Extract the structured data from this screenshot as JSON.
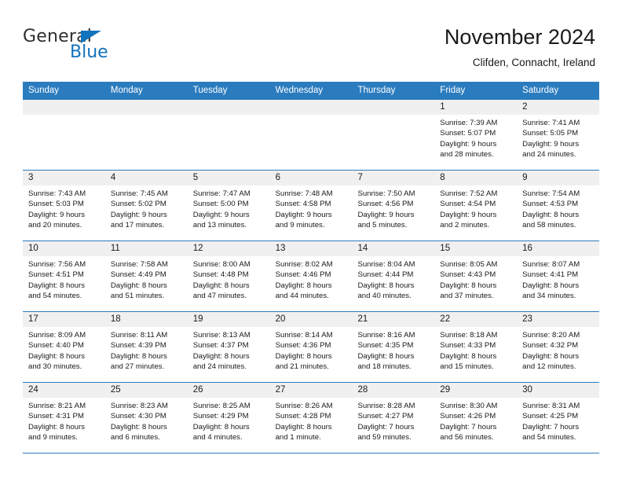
{
  "logo": {
    "word_top": "General",
    "word_bottom": "Blue",
    "triangle_color": "#1273bd",
    "text_color": "#2e2e2e"
  },
  "header": {
    "title": "November 2024",
    "subtitle": "Clifden, Connacht, Ireland"
  },
  "theme": {
    "header_band": "#2b7cbf",
    "daynum_band": "#f0f0f0",
    "rule": "#2b7cbf"
  },
  "weekdays": [
    "Sunday",
    "Monday",
    "Tuesday",
    "Wednesday",
    "Thursday",
    "Friday",
    "Saturday"
  ],
  "weeks": [
    [
      {
        "day": "",
        "lines": []
      },
      {
        "day": "",
        "lines": []
      },
      {
        "day": "",
        "lines": []
      },
      {
        "day": "",
        "lines": []
      },
      {
        "day": "",
        "lines": []
      },
      {
        "day": "1",
        "lines": [
          "Sunrise: 7:39 AM",
          "Sunset: 5:07 PM",
          "Daylight: 9 hours",
          "and 28 minutes."
        ]
      },
      {
        "day": "2",
        "lines": [
          "Sunrise: 7:41 AM",
          "Sunset: 5:05 PM",
          "Daylight: 9 hours",
          "and 24 minutes."
        ]
      }
    ],
    [
      {
        "day": "3",
        "lines": [
          "Sunrise: 7:43 AM",
          "Sunset: 5:03 PM",
          "Daylight: 9 hours",
          "and 20 minutes."
        ]
      },
      {
        "day": "4",
        "lines": [
          "Sunrise: 7:45 AM",
          "Sunset: 5:02 PM",
          "Daylight: 9 hours",
          "and 17 minutes."
        ]
      },
      {
        "day": "5",
        "lines": [
          "Sunrise: 7:47 AM",
          "Sunset: 5:00 PM",
          "Daylight: 9 hours",
          "and 13 minutes."
        ]
      },
      {
        "day": "6",
        "lines": [
          "Sunrise: 7:48 AM",
          "Sunset: 4:58 PM",
          "Daylight: 9 hours",
          "and 9 minutes."
        ]
      },
      {
        "day": "7",
        "lines": [
          "Sunrise: 7:50 AM",
          "Sunset: 4:56 PM",
          "Daylight: 9 hours",
          "and 5 minutes."
        ]
      },
      {
        "day": "8",
        "lines": [
          "Sunrise: 7:52 AM",
          "Sunset: 4:54 PM",
          "Daylight: 9 hours",
          "and 2 minutes."
        ]
      },
      {
        "day": "9",
        "lines": [
          "Sunrise: 7:54 AM",
          "Sunset: 4:53 PM",
          "Daylight: 8 hours",
          "and 58 minutes."
        ]
      }
    ],
    [
      {
        "day": "10",
        "lines": [
          "Sunrise: 7:56 AM",
          "Sunset: 4:51 PM",
          "Daylight: 8 hours",
          "and 54 minutes."
        ]
      },
      {
        "day": "11",
        "lines": [
          "Sunrise: 7:58 AM",
          "Sunset: 4:49 PM",
          "Daylight: 8 hours",
          "and 51 minutes."
        ]
      },
      {
        "day": "12",
        "lines": [
          "Sunrise: 8:00 AM",
          "Sunset: 4:48 PM",
          "Daylight: 8 hours",
          "and 47 minutes."
        ]
      },
      {
        "day": "13",
        "lines": [
          "Sunrise: 8:02 AM",
          "Sunset: 4:46 PM",
          "Daylight: 8 hours",
          "and 44 minutes."
        ]
      },
      {
        "day": "14",
        "lines": [
          "Sunrise: 8:04 AM",
          "Sunset: 4:44 PM",
          "Daylight: 8 hours",
          "and 40 minutes."
        ]
      },
      {
        "day": "15",
        "lines": [
          "Sunrise: 8:05 AM",
          "Sunset: 4:43 PM",
          "Daylight: 8 hours",
          "and 37 minutes."
        ]
      },
      {
        "day": "16",
        "lines": [
          "Sunrise: 8:07 AM",
          "Sunset: 4:41 PM",
          "Daylight: 8 hours",
          "and 34 minutes."
        ]
      }
    ],
    [
      {
        "day": "17",
        "lines": [
          "Sunrise: 8:09 AM",
          "Sunset: 4:40 PM",
          "Daylight: 8 hours",
          "and 30 minutes."
        ]
      },
      {
        "day": "18",
        "lines": [
          "Sunrise: 8:11 AM",
          "Sunset: 4:39 PM",
          "Daylight: 8 hours",
          "and 27 minutes."
        ]
      },
      {
        "day": "19",
        "lines": [
          "Sunrise: 8:13 AM",
          "Sunset: 4:37 PM",
          "Daylight: 8 hours",
          "and 24 minutes."
        ]
      },
      {
        "day": "20",
        "lines": [
          "Sunrise: 8:14 AM",
          "Sunset: 4:36 PM",
          "Daylight: 8 hours",
          "and 21 minutes."
        ]
      },
      {
        "day": "21",
        "lines": [
          "Sunrise: 8:16 AM",
          "Sunset: 4:35 PM",
          "Daylight: 8 hours",
          "and 18 minutes."
        ]
      },
      {
        "day": "22",
        "lines": [
          "Sunrise: 8:18 AM",
          "Sunset: 4:33 PM",
          "Daylight: 8 hours",
          "and 15 minutes."
        ]
      },
      {
        "day": "23",
        "lines": [
          "Sunrise: 8:20 AM",
          "Sunset: 4:32 PM",
          "Daylight: 8 hours",
          "and 12 minutes."
        ]
      }
    ],
    [
      {
        "day": "24",
        "lines": [
          "Sunrise: 8:21 AM",
          "Sunset: 4:31 PM",
          "Daylight: 8 hours",
          "and 9 minutes."
        ]
      },
      {
        "day": "25",
        "lines": [
          "Sunrise: 8:23 AM",
          "Sunset: 4:30 PM",
          "Daylight: 8 hours",
          "and 6 minutes."
        ]
      },
      {
        "day": "26",
        "lines": [
          "Sunrise: 8:25 AM",
          "Sunset: 4:29 PM",
          "Daylight: 8 hours",
          "and 4 minutes."
        ]
      },
      {
        "day": "27",
        "lines": [
          "Sunrise: 8:26 AM",
          "Sunset: 4:28 PM",
          "Daylight: 8 hours",
          "and 1 minute."
        ]
      },
      {
        "day": "28",
        "lines": [
          "Sunrise: 8:28 AM",
          "Sunset: 4:27 PM",
          "Daylight: 7 hours",
          "and 59 minutes."
        ]
      },
      {
        "day": "29",
        "lines": [
          "Sunrise: 8:30 AM",
          "Sunset: 4:26 PM",
          "Daylight: 7 hours",
          "and 56 minutes."
        ]
      },
      {
        "day": "30",
        "lines": [
          "Sunrise: 8:31 AM",
          "Sunset: 4:25 PM",
          "Daylight: 7 hours",
          "and 54 minutes."
        ]
      }
    ]
  ]
}
